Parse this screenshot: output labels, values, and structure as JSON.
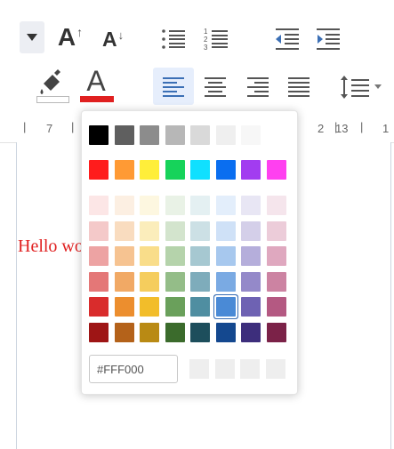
{
  "toolbar": {
    "grow_font": {
      "letter": "A",
      "arrow": "↑",
      "icon": "increase-font-size-icon"
    },
    "shrink_font": {
      "letter": "A",
      "arrow": "↓",
      "icon": "decrease-font-size-icon"
    },
    "font_color": {
      "letter": "A",
      "current": "#e02020"
    },
    "highlight": {
      "current": "#ffffff"
    }
  },
  "ruler": {
    "labels": [
      "7",
      "2",
      "13",
      "1"
    ]
  },
  "document": {
    "text": "Hello wo"
  },
  "color_picker": {
    "row_basic": [
      "#000000",
      "#5f5f5f",
      "#8c8c8c",
      "#b7b7b7",
      "#d9d9d9",
      "#efefef",
      "#f7f7f7"
    ],
    "row_bright": [
      "#ff1c1c",
      "#ff9a34",
      "#ffee3a",
      "#16d35a",
      "#10e0ff",
      "#0a6ef0",
      "#a23cf0",
      "#ff40f0"
    ],
    "grid": [
      [
        "#fce6e6",
        "#fcefe2",
        "#fdf7e0",
        "#e9f2e6",
        "#e4f0f2",
        "#e3eefb",
        "#e8e6f4",
        "#f5e5ec"
      ],
      [
        "#f4c9c9",
        "#f9dcbf",
        "#fbedbb",
        "#d3e4cd",
        "#cce0e5",
        "#cfe1f7",
        "#d4cfe9",
        "#ecccd9"
      ],
      [
        "#eda3a3",
        "#f6c391",
        "#f9dd8a",
        "#b5d3ab",
        "#a6c8d1",
        "#a7c8ee",
        "#b5aedb",
        "#dfa8bf"
      ],
      [
        "#e47777",
        "#f1a965",
        "#f5cd5d",
        "#94bd88",
        "#7eacbb",
        "#7aaae3",
        "#9489c9",
        "#cc83a2"
      ],
      [
        "#d92c2c",
        "#ec8e2e",
        "#f2bd2a",
        "#6aa05b",
        "#4f8ea1",
        "#4a8ad6",
        "#6e62b3",
        "#b45982"
      ],
      [
        "#9e1515",
        "#b4621a",
        "#b98a14",
        "#3b6b2c",
        "#1d4e5c",
        "#14488f",
        "#3d2e7c",
        "#7b2248"
      ]
    ],
    "selected": "#4a8ad6",
    "hex_value": "#FFF000",
    "recent": [
      "#eeeeee",
      "#eeeeee",
      "#eeeeee",
      "#eeeeee"
    ]
  }
}
